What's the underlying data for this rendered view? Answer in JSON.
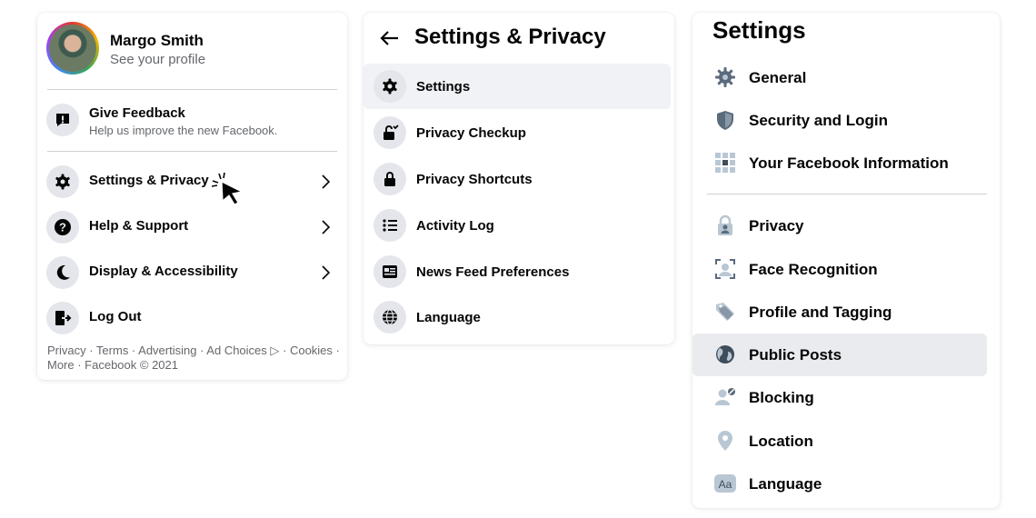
{
  "menu": {
    "profile": {
      "name": "Margo Smith",
      "subtitle": "See your profile"
    },
    "feedback": {
      "title": "Give Feedback",
      "subtitle": "Help us improve the new Facebook."
    },
    "items": [
      {
        "label": "Settings & Privacy",
        "icon": "gear-icon"
      },
      {
        "label": "Help & Support",
        "icon": "question-icon"
      },
      {
        "label": "Display & Accessibility",
        "icon": "moon-icon"
      },
      {
        "label": "Log Out",
        "icon": "logout-icon"
      }
    ],
    "footer": "Privacy · Terms · Advertising · Ad Choices ▷ · Cookies · More · Facebook © 2021"
  },
  "settings_privacy": {
    "title": "Settings & Privacy",
    "items": [
      {
        "label": "Settings",
        "icon": "gear-icon"
      },
      {
        "label": "Privacy Checkup",
        "icon": "lock-check-icon"
      },
      {
        "label": "Privacy Shortcuts",
        "icon": "lock-icon"
      },
      {
        "label": "Activity Log",
        "icon": "list-icon"
      },
      {
        "label": "News Feed Preferences",
        "icon": "feed-icon"
      },
      {
        "label": "Language",
        "icon": "globe-icon"
      }
    ]
  },
  "settings": {
    "title": "Settings",
    "group1": [
      {
        "label": "General",
        "icon": "gear-icon"
      },
      {
        "label": "Security and Login",
        "icon": "shield-icon"
      },
      {
        "label": "Your Facebook Information",
        "icon": "grid-icon"
      }
    ],
    "group2": [
      {
        "label": "Privacy",
        "icon": "privacy-lock-icon"
      },
      {
        "label": "Face Recognition",
        "icon": "face-icon"
      },
      {
        "label": "Profile and Tagging",
        "icon": "tag-icon"
      },
      {
        "label": "Public Posts",
        "icon": "globe-icon"
      },
      {
        "label": "Blocking",
        "icon": "block-user-icon"
      },
      {
        "label": "Location",
        "icon": "location-pin-icon"
      },
      {
        "label": "Language",
        "icon": "language-icon"
      }
    ]
  },
  "colors": {
    "highlight": "#f0f2f5",
    "icon_bg": "#e4e6eb",
    "secondary_text": "#65676b",
    "settings_icon": "#607080"
  }
}
